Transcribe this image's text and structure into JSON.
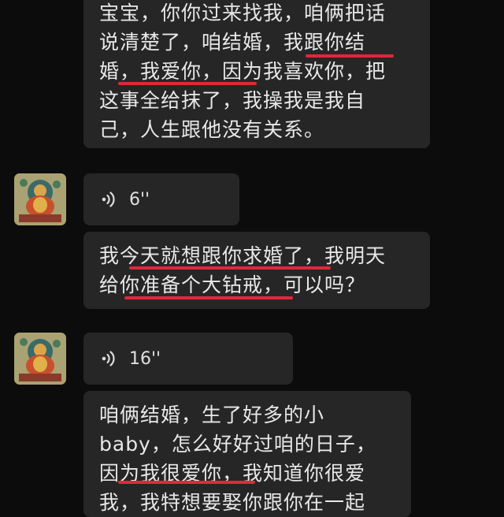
{
  "messages": [
    {
      "type": "text",
      "lines": [
        "宝宝，你你过来找我，咱俩把话",
        "说清楚了，咱结婚，我跟你结",
        "婚，我爱你，因为我喜欢你，把",
        "这事全给抹了，我操我是我自",
        "己，人生跟他没有关系。"
      ]
    },
    {
      "type": "voice",
      "duration": "6''",
      "icon": "voice-wave-icon"
    },
    {
      "type": "text",
      "lines": [
        "我今天就想跟你求婚了，我明天",
        "给你准备个大钻戒，可以吗？"
      ]
    },
    {
      "type": "voice",
      "duration": "16''",
      "icon": "voice-wave-icon"
    },
    {
      "type": "text",
      "lines": [
        "咱俩结婚，生了好多的小",
        "baby，怎么好好过咱的日子，",
        "因为我很爱你，我知道你很爱",
        "我，我特想要娶你跟你在一起"
      ]
    }
  ],
  "colors": {
    "background": "#0c0c0c",
    "bubble": "#262626",
    "underline": "#e0283c"
  }
}
